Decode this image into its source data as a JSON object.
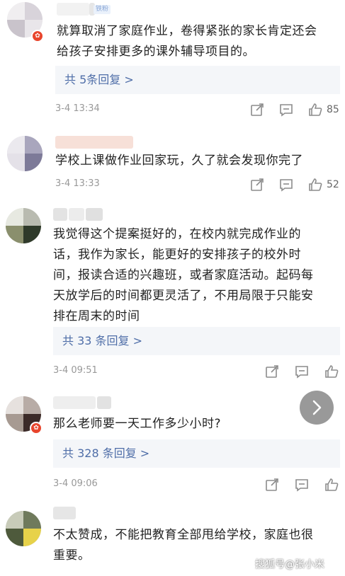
{
  "comments": [
    {
      "text_lines": [
        "就算取消了家庭作业，卷得紧张的家长肯定还会",
        "给孩子安排更多的课外辅导项目的。"
      ],
      "tag": "铁粉",
      "replies": "共 5条回复 >",
      "time": "3-4 13:34",
      "likes": "85"
    },
    {
      "text_lines": [
        "学校上课做作业回家玩，久了就会发现你完了"
      ],
      "replies": "",
      "time": "3-4 13:33",
      "likes": "52"
    },
    {
      "text_lines": [
        "我觉得这个提案挺好的，在校内就完成作业的",
        "话，我作为家长，能更好的安排孩子的校外时",
        "间，报读合适的兴趣班，或者家庭活动。起码每",
        "天放学后的时间都更灵活了，不用局限于只能安",
        "排在周末的时间"
      ],
      "replies": "共 33 条回复 >",
      "time": "3-4 09:51",
      "likes": ""
    },
    {
      "text_lines": [
        "那么老师要一天工作多少小时?"
      ],
      "replies": "共 328 条回复 >",
      "time": "3-4 09:06",
      "likes": ""
    },
    {
      "text_lines": [
        "不太赞成，不能把教育全部甩给学校，家庭也很",
        "重要。"
      ],
      "replies": "",
      "time": "",
      "likes": ""
    }
  ],
  "watermark": "搜狐号@张小米",
  "icons": {
    "share": "share-icon",
    "comment": "comment-icon",
    "like": "thumbs-up-icon",
    "next": "chevron-right-icon"
  },
  "colors": {
    "reply_link": "#4f6ea8",
    "reply_bg": "#f4f6f9",
    "text": "#222222",
    "meta": "#999999",
    "badge": "#e8452c"
  }
}
